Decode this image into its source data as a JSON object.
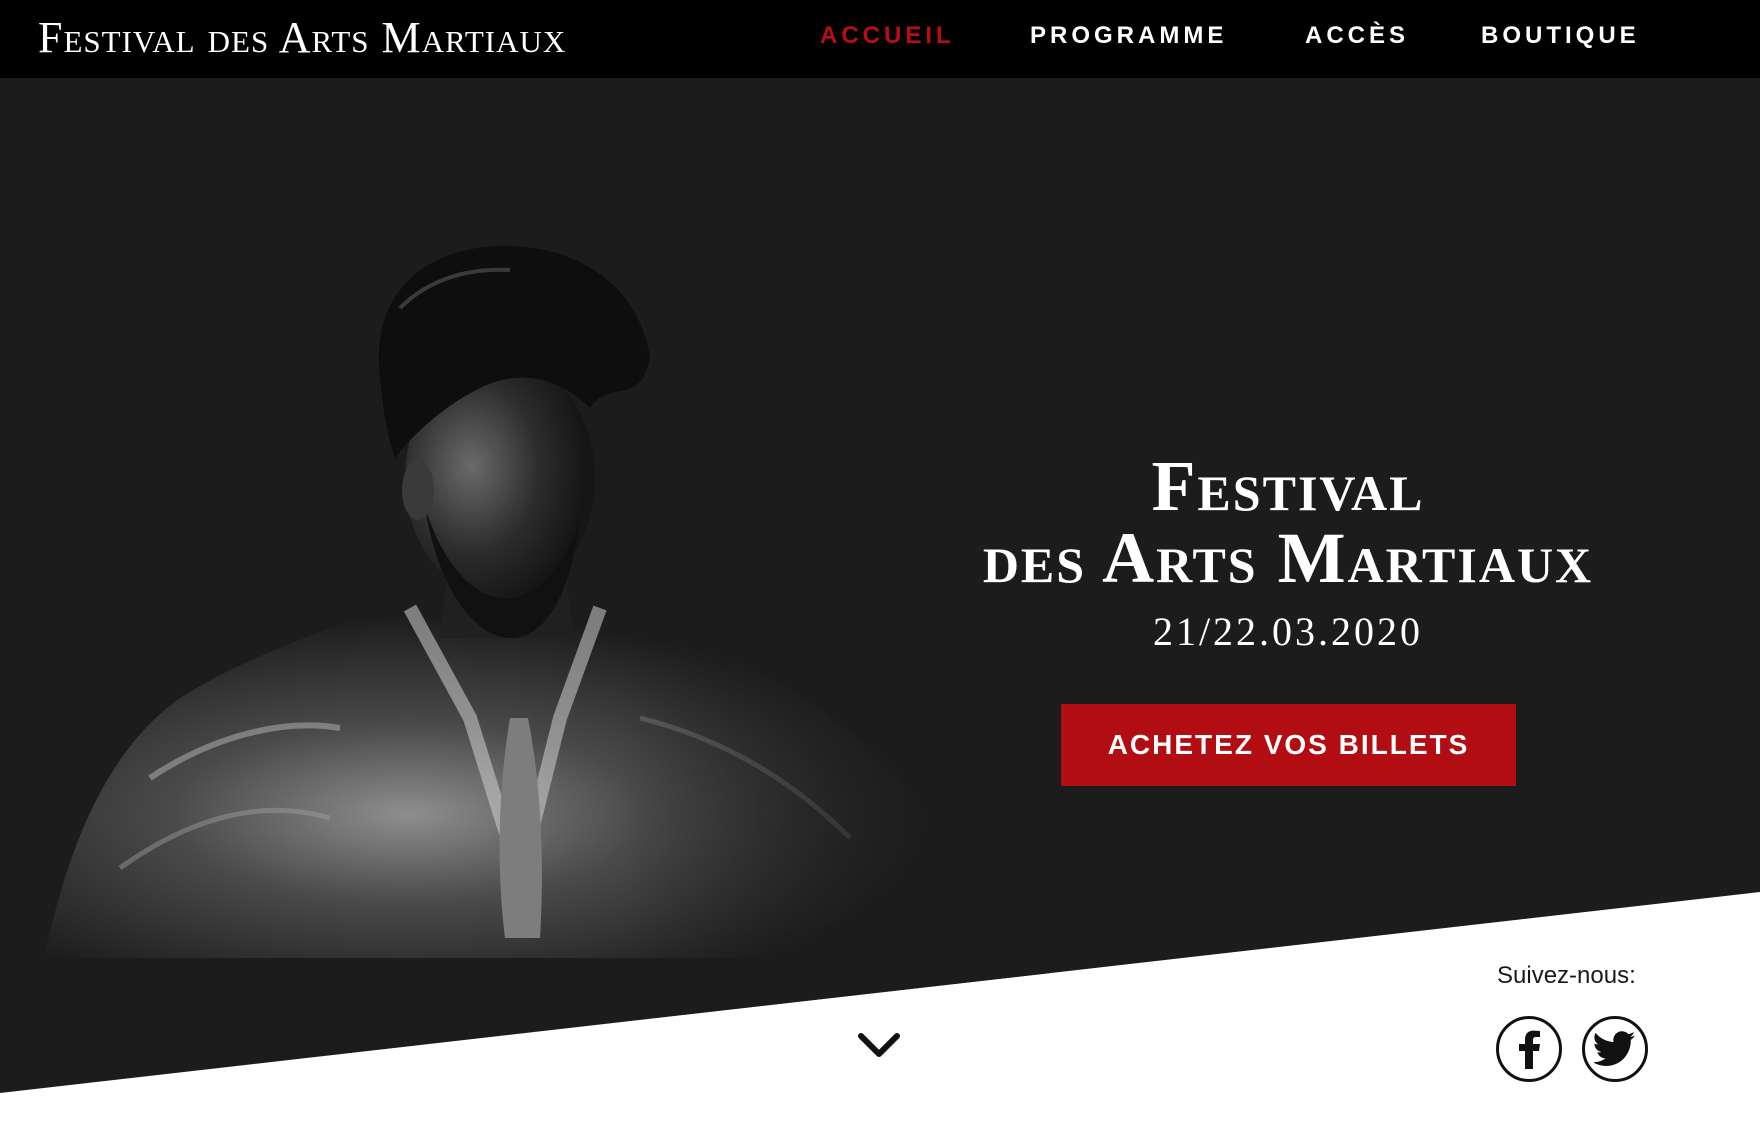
{
  "header": {
    "brand": "Festival des Arts Martiaux",
    "nav": [
      {
        "label": "ACCUEIL",
        "active": true
      },
      {
        "label": "PROGRAMME",
        "active": false
      },
      {
        "label": "ACCÈS",
        "active": false
      },
      {
        "label": "BOUTIQUE",
        "active": false
      }
    ]
  },
  "hero": {
    "title_line1": "Festival",
    "title_line2": "des Arts Martiaux",
    "date": "21/22.03.2020",
    "cta_label": "ACHETEZ VOS BILLETS"
  },
  "footer": {
    "follow_label": "Suivez-nous:",
    "social": [
      {
        "icon": "facebook-icon"
      },
      {
        "icon": "twitter-icon"
      }
    ],
    "scroll_icon": "chevron-down-icon"
  },
  "colors": {
    "nav_background": "#000000",
    "hero_background": "#1c1c1d",
    "accent": "#b20d12",
    "text_light": "#ffffff"
  }
}
